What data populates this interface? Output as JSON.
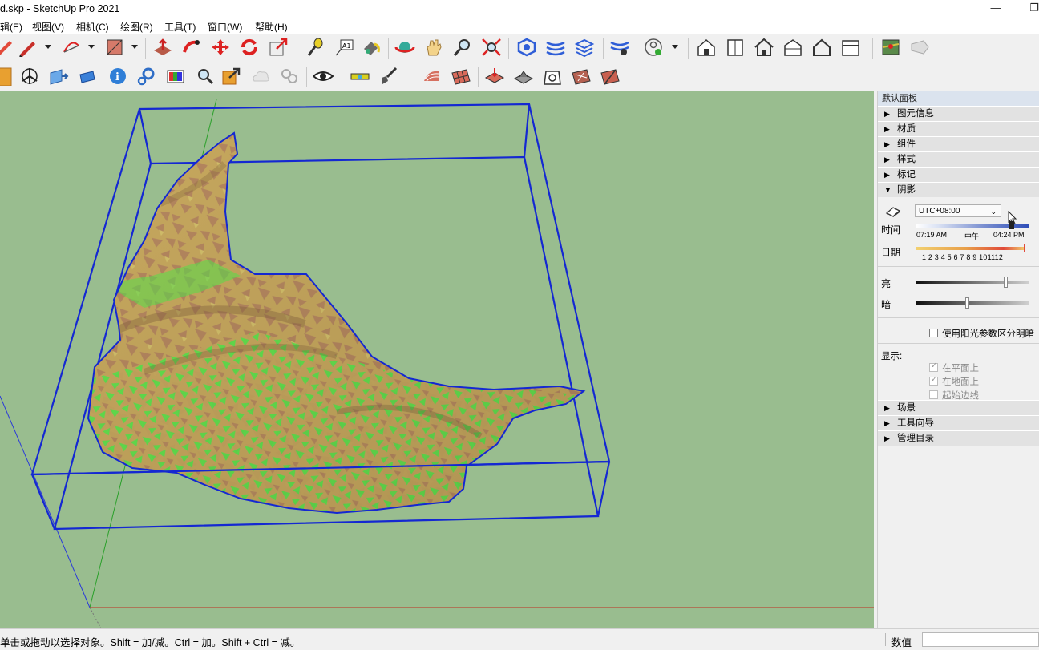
{
  "window": {
    "title": "d.skp - SketchUp Pro 2021",
    "minimize_glyph": "—",
    "restore_glyph": "❐"
  },
  "menu": [
    "辑(E)",
    "视图(V)",
    "相机(C)",
    "绘图(R)",
    "工具(T)",
    "窗口(W)",
    "帮助(H)"
  ],
  "toolbar1_icons": [
    "pencil-icon",
    "line-icon",
    "arc-icon",
    "rectangle-icon",
    "push-pull-icon",
    "follow-me-icon",
    "move-icon",
    "rotate-icon",
    "scale-icon",
    "tape-measure-icon",
    "text-icon",
    "paint-bucket-icon",
    "orbit-icon",
    "pan-icon",
    "zoom-icon",
    "zoom-extents-icon",
    "solid-tools-icon",
    "sandbox-icon",
    "layers-icon",
    "extension-icon",
    "account-icon",
    "warehouse-icon",
    "components-icon",
    "home-icon",
    "house-section-icon",
    "house-outline-icon",
    "garage-icon",
    "geo-location-icon",
    "tag-icon"
  ],
  "toolbar2_icons": [
    "sketchup-logo-icon",
    "axes-icon",
    "section-plane-icon",
    "section-fill-icon",
    "info-icon",
    "settings-icon",
    "style-icon",
    "zoom-window-icon",
    "export-icon",
    "cloud-icon",
    "link-icon",
    "eye-icon",
    "level-icon",
    "shovel-icon",
    "terrain-from-contours-icon",
    "terrain-grid-icon",
    "smoove-icon",
    "stamp-icon",
    "drape-icon",
    "add-detail-icon",
    "flip-edge-icon"
  ],
  "panel": {
    "title": "默认面板",
    "sections_top": [
      {
        "label": "图元信息",
        "expanded": false
      },
      {
        "label": "材质",
        "expanded": false
      },
      {
        "label": "组件",
        "expanded": false
      },
      {
        "label": "样式",
        "expanded": false
      },
      {
        "label": "标记",
        "expanded": false
      },
      {
        "label": "阴影",
        "expanded": true
      }
    ],
    "tri_collapsed": "▶",
    "tri_expanded": "▼",
    "shadow": {
      "timezone": "UTC+08:00",
      "time_label": "时间",
      "time_start": "07:19 AM",
      "time_noon": "中午",
      "time_end": "04:24 PM",
      "date_label": "日期",
      "months": "1 2 3 4 5 6 7 8 9 101112",
      "light_label": "亮",
      "dark_label": "暗",
      "light_level": 0.79,
      "dark_level": 0.45,
      "use_sun_label": "使用阳光参数区分明暗",
      "use_sun_checked": false,
      "display_label": "显示:",
      "display_options": [
        {
          "label": "在平面上",
          "checked": true
        },
        {
          "label": "在地面上",
          "checked": true
        },
        {
          "label": "起始边线",
          "checked": false
        }
      ],
      "check_glyph": "✓"
    },
    "sections_bottom": [
      {
        "label": "场景",
        "expanded": false
      },
      {
        "label": "工具向导",
        "expanded": false
      },
      {
        "label": "管理目录",
        "expanded": false
      }
    ]
  },
  "status": {
    "text": "单击或拖动以选择对象。Shift = 加/减。Ctrl = 加。Shift + Ctrl = 减。",
    "value_label": "数值",
    "value": ""
  },
  "colors": {
    "viewport_bg": "#99bd8f",
    "bounding_box": "#1428d2",
    "terrain_tan": "#c7a85e",
    "terrain_brown": "#b5875f",
    "terrain_green": "#58e64c",
    "accent_blue": "#2f5ed7"
  }
}
